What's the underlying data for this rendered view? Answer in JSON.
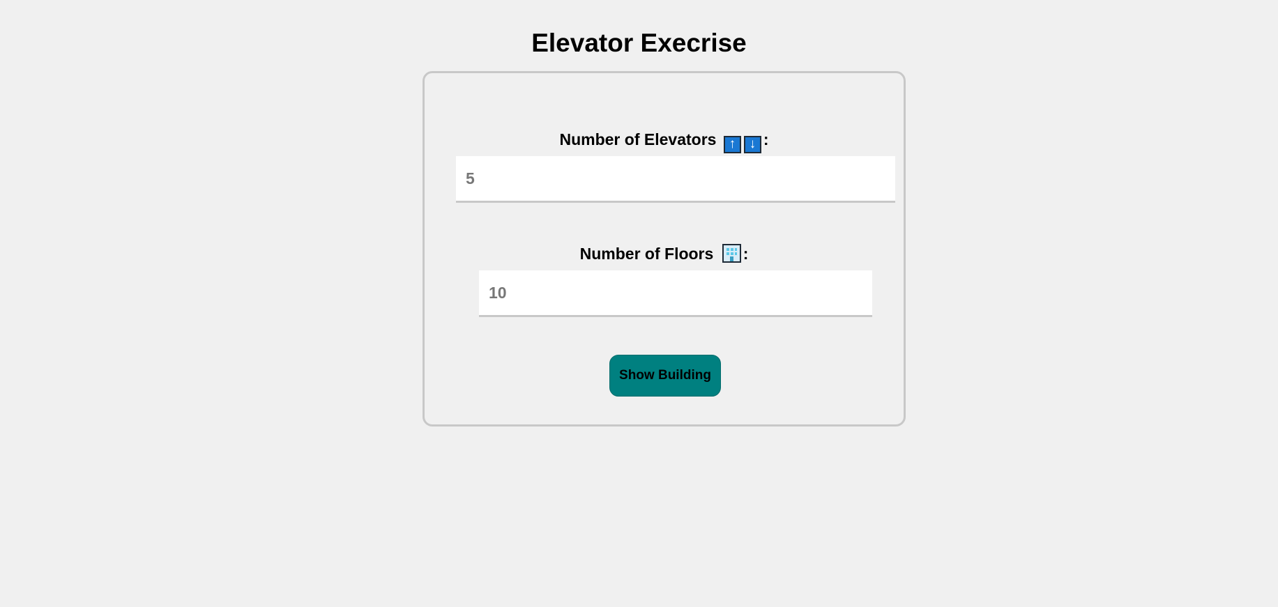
{
  "page": {
    "title": "Elevator Execrise"
  },
  "form": {
    "elevators": {
      "label": "Number of Elevators",
      "icons": [
        "up-arrow-icon",
        "down-arrow-icon"
      ],
      "up_glyph": "↑",
      "down_glyph": "↓",
      "suffix": ":",
      "value": "",
      "placeholder": "5"
    },
    "floors": {
      "label": "Number of Floors",
      "icon": "building-icon",
      "suffix": ":",
      "value": "",
      "placeholder": "10"
    },
    "submit_label": "Show Building"
  },
  "colors": {
    "background": "#f0f0f0",
    "card_border": "#c8c8c8",
    "button": "#008080",
    "arrow_icon": "#1a78d3",
    "placeholder_text": "#777777"
  }
}
